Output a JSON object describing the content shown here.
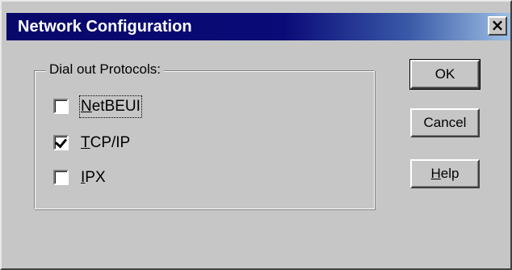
{
  "window": {
    "title": "Network Configuration",
    "close_glyph": "×"
  },
  "group": {
    "label": "Dial out Protocols:"
  },
  "protocols": [
    {
      "first": "N",
      "rest": "etBEUI",
      "checked": false
    },
    {
      "first": "T",
      "rest": "CP/IP",
      "checked": true
    },
    {
      "first": "I",
      "rest": "PX",
      "checked": false
    }
  ],
  "buttons": {
    "ok": "OK",
    "cancel": "Cancel",
    "help_first": "H",
    "help_rest": "elp"
  },
  "colors": {
    "face": "#c6c6c6",
    "title_start": "#08086b",
    "title_end": "#9ec0e4"
  }
}
